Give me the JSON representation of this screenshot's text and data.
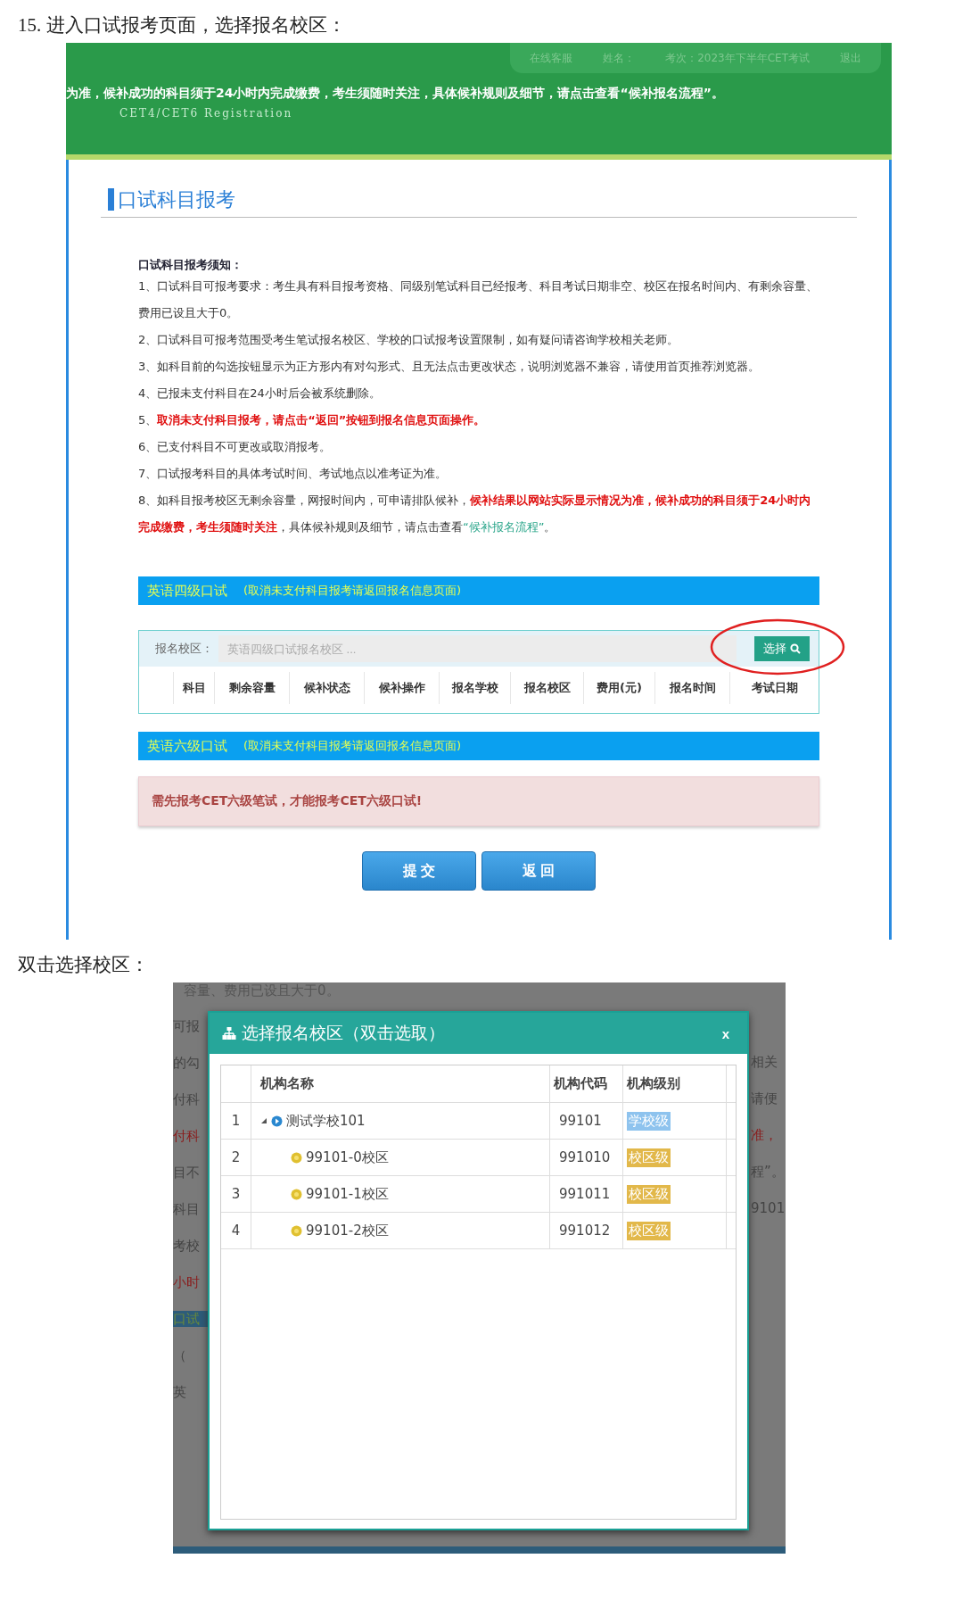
{
  "caption_1": "15. 进入口试报考页面，选择报名校区：",
  "screenshot_1": {
    "top_nav": [
      "在线客服",
      "姓名：",
      "考次：2023年下半年CET考试",
      "退出"
    ],
    "banner_text": "为准，候补成功的科目须于24小时内完成缴费，考生须随时关注，具体候补规则及细节，请点击查看“候补报名流程”。",
    "logo_text": "CET4/CET6  Registration",
    "page_title": "口试科目报考",
    "notice_title": "口试科目报考须知：",
    "notice_items": [
      [
        {
          "kind": "normal",
          "text": "1、口试科目可报考要求：考生具有科目报考资格、同级别笔试科目已经报考、科目考试日期非空、校区在报名时间内、有剩余容量、费用已设且大于0。"
        }
      ],
      [
        {
          "kind": "normal",
          "text": "2、口试科目可报考范围受考生笔试报名校区、学校的口试报考设置限制，如有疑问请咨询学校相关老师。"
        }
      ],
      [
        {
          "kind": "normal",
          "text": "3、如科目前的勾选按钮显示为正方形内有对勾形式、且无法点击更改状态，说明浏览器不兼容，请使用首页推荐浏览器。"
        }
      ],
      [
        {
          "kind": "normal",
          "text": "4、已报未支付科目在24小时后会被系统删除。"
        }
      ],
      [
        {
          "kind": "normal",
          "text": "5、"
        },
        {
          "kind": "alert",
          "text": "取消未支付科目报考，请点击“返回”按钮到报名信息页面操作。"
        }
      ],
      [
        {
          "kind": "normal",
          "text": "6、已支付科目不可更改或取消报考。"
        }
      ],
      [
        {
          "kind": "normal",
          "text": "7、口试报考科目的具体考试时间、考试地点以准考证为准。"
        }
      ],
      [
        {
          "kind": "normal",
          "text": "8、如科目报考校区无剩余容量，网报时间内，可申请排队候补，"
        },
        {
          "kind": "alert",
          "text": "候补结果以网站实际显示情况为准，候补成功的科目须于24小时内完成缴费，考生须随时关注"
        },
        {
          "kind": "normal",
          "text": "，具体候补规则及细节，请点击查看"
        },
        {
          "kind": "link",
          "text": "“候补报名流程”"
        },
        {
          "kind": "normal",
          "text": "。"
        }
      ]
    ],
    "sections": [
      {
        "kind": "table",
        "title": "英语四级口试",
        "note": "(取消未支付科目报考请返回报名信息页面)",
        "field_label": "报名校区：",
        "placeholder": "英语四级口试报名校区 ...",
        "button": "选择",
        "columns": [
          "科目",
          "剩余容量",
          "候补状态",
          "候补操作",
          "报名学校",
          "报名校区",
          "费用(元)",
          "报名时间",
          "考试日期"
        ]
      },
      {
        "kind": "alert",
        "title": "英语六级口试",
        "note": "(取消未支付科目报考请返回报名信息页面)",
        "message": "需先报考CET六级笔试，才能报考CET六级口试!"
      }
    ],
    "buttons": [
      "提 交",
      "返 回"
    ]
  },
  "caption_2": "双击选择校区：",
  "screenshot_2": {
    "backdrop_top": "容量、费用已设且大于0。",
    "backdrop_left": [
      {
        "kind": "normal",
        "text": "可报"
      },
      {
        "kind": "normal",
        "text": "的勾"
      },
      {
        "kind": "normal",
        "text": "付科"
      },
      {
        "kind": "alert",
        "text": "付科"
      },
      {
        "kind": "normal",
        "text": "目不"
      },
      {
        "kind": "normal",
        "text": "科目"
      },
      {
        "kind": "normal",
        "text": "考校"
      },
      {
        "kind": "alert",
        "text": "小时"
      },
      {
        "kind": "banner",
        "text": "口试"
      },
      {
        "kind": "normal",
        "text": "（"
      },
      {
        "kind": "normal",
        "text": "英"
      }
    ],
    "backdrop_right": [
      {
        "kind": "normal",
        "text": "相关"
      },
      {
        "kind": "normal",
        "text": "请便"
      },
      {
        "kind": "alert",
        "text": "准，"
      },
      {
        "kind": "normal",
        "text": "程”。"
      },
      {
        "kind": "normal",
        "text": "9101"
      }
    ],
    "dialog": {
      "title": "选择报名校区（双击选取）",
      "close": "x",
      "columns": [
        "机构名称",
        "机构代码",
        "机构级别"
      ],
      "rows": [
        {
          "number": "1",
          "name": "测试学校101",
          "code": "99101",
          "level": "学校级",
          "kind": "school",
          "expanded": true,
          "children": [
            {
              "number": "2",
              "name": "99101-0校区",
              "code": "991010",
              "level": "校区级",
              "kind": "campus"
            },
            {
              "number": "3",
              "name": "99101-1校区",
              "code": "991011",
              "level": "校区级",
              "kind": "campus"
            },
            {
              "number": "4",
              "name": "99101-2校区",
              "code": "991012",
              "level": "校区级",
              "kind": "campus"
            }
          ]
        }
      ]
    }
  }
}
